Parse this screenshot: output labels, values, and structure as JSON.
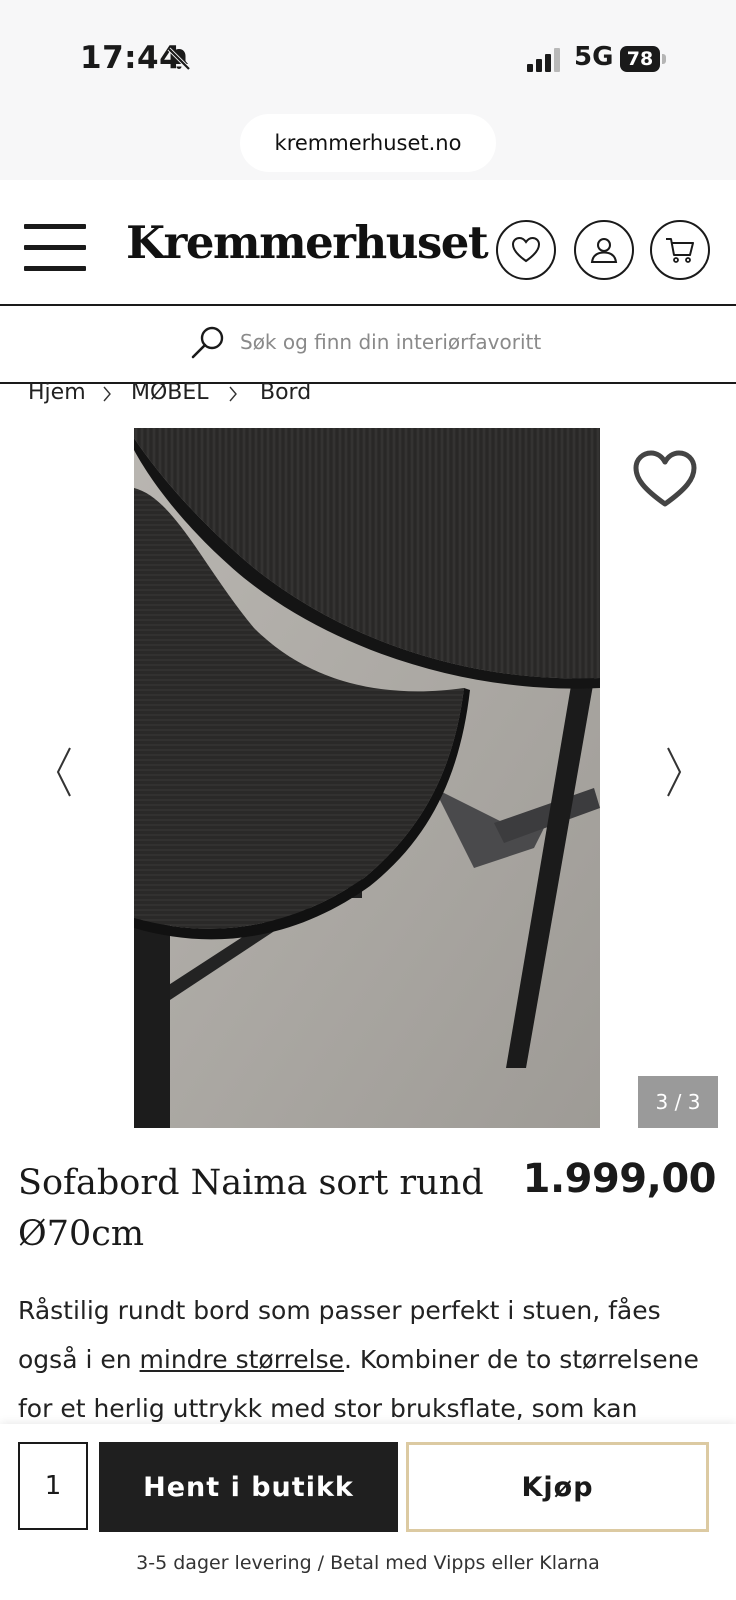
{
  "status_bar": {
    "time": "17:44",
    "network": "5G",
    "battery": "78"
  },
  "browser": {
    "url": "kremmerhuset.no"
  },
  "header": {
    "logo": "Kremmerhuset"
  },
  "search": {
    "placeholder": "Søk og finn din interiørfavoritt"
  },
  "breadcrumb": [
    "Hjem",
    "MØBEL",
    "Bord"
  ],
  "gallery": {
    "counter": "3 / 3"
  },
  "product": {
    "title": "Sofabord Naima sort rund Ø70cm",
    "price": "1.999,00",
    "description_part1": "Råstilig rundt bord som passer perfekt i stuen, fåes også i en ",
    "description_link": "mindre størrelse",
    "description_part2": ". Kombiner de to størrelsene for et herlig uttrykk med stor bruksflate, som kan skyves"
  },
  "purchase": {
    "quantity": "1",
    "pickup_label": "Hent i butikk",
    "buy_label": "Kjøp",
    "delivery_note": "3-5 dager levering / Betal med Vipps eller Klarna"
  },
  "colors": {
    "primary": "#1f1f1f",
    "buy_border": "#dccaa2",
    "counter_bg": "#9a9a9a"
  }
}
